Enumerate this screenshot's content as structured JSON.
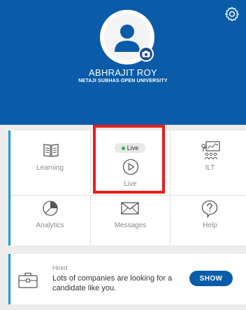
{
  "profile": {
    "name": "ABHRAJIT ROY",
    "organization": "NETAJI SUBHAS OPEN UNIVERSITY"
  },
  "tiles": [
    {
      "label": "Learning",
      "icon": "book-icon"
    },
    {
      "label": "Live",
      "icon": "play-circle-icon",
      "badge": "Live"
    },
    {
      "label": "ILT",
      "icon": "classroom-icon"
    },
    {
      "label": "Analytics",
      "icon": "pie-chart-icon"
    },
    {
      "label": "Messages",
      "icon": "envelope-icon"
    },
    {
      "label": "Help",
      "icon": "question-icon"
    }
  ],
  "hired_card": {
    "tag": "Hired",
    "message": "Lots of companies are looking for a candidate like you.",
    "button": "SHOW",
    "icon": "briefcase-icon"
  },
  "colors": {
    "header": "#0a5ca8",
    "accent": "#1a9be0",
    "highlight": "#e81d1d",
    "live_dot": "#2fb344"
  }
}
